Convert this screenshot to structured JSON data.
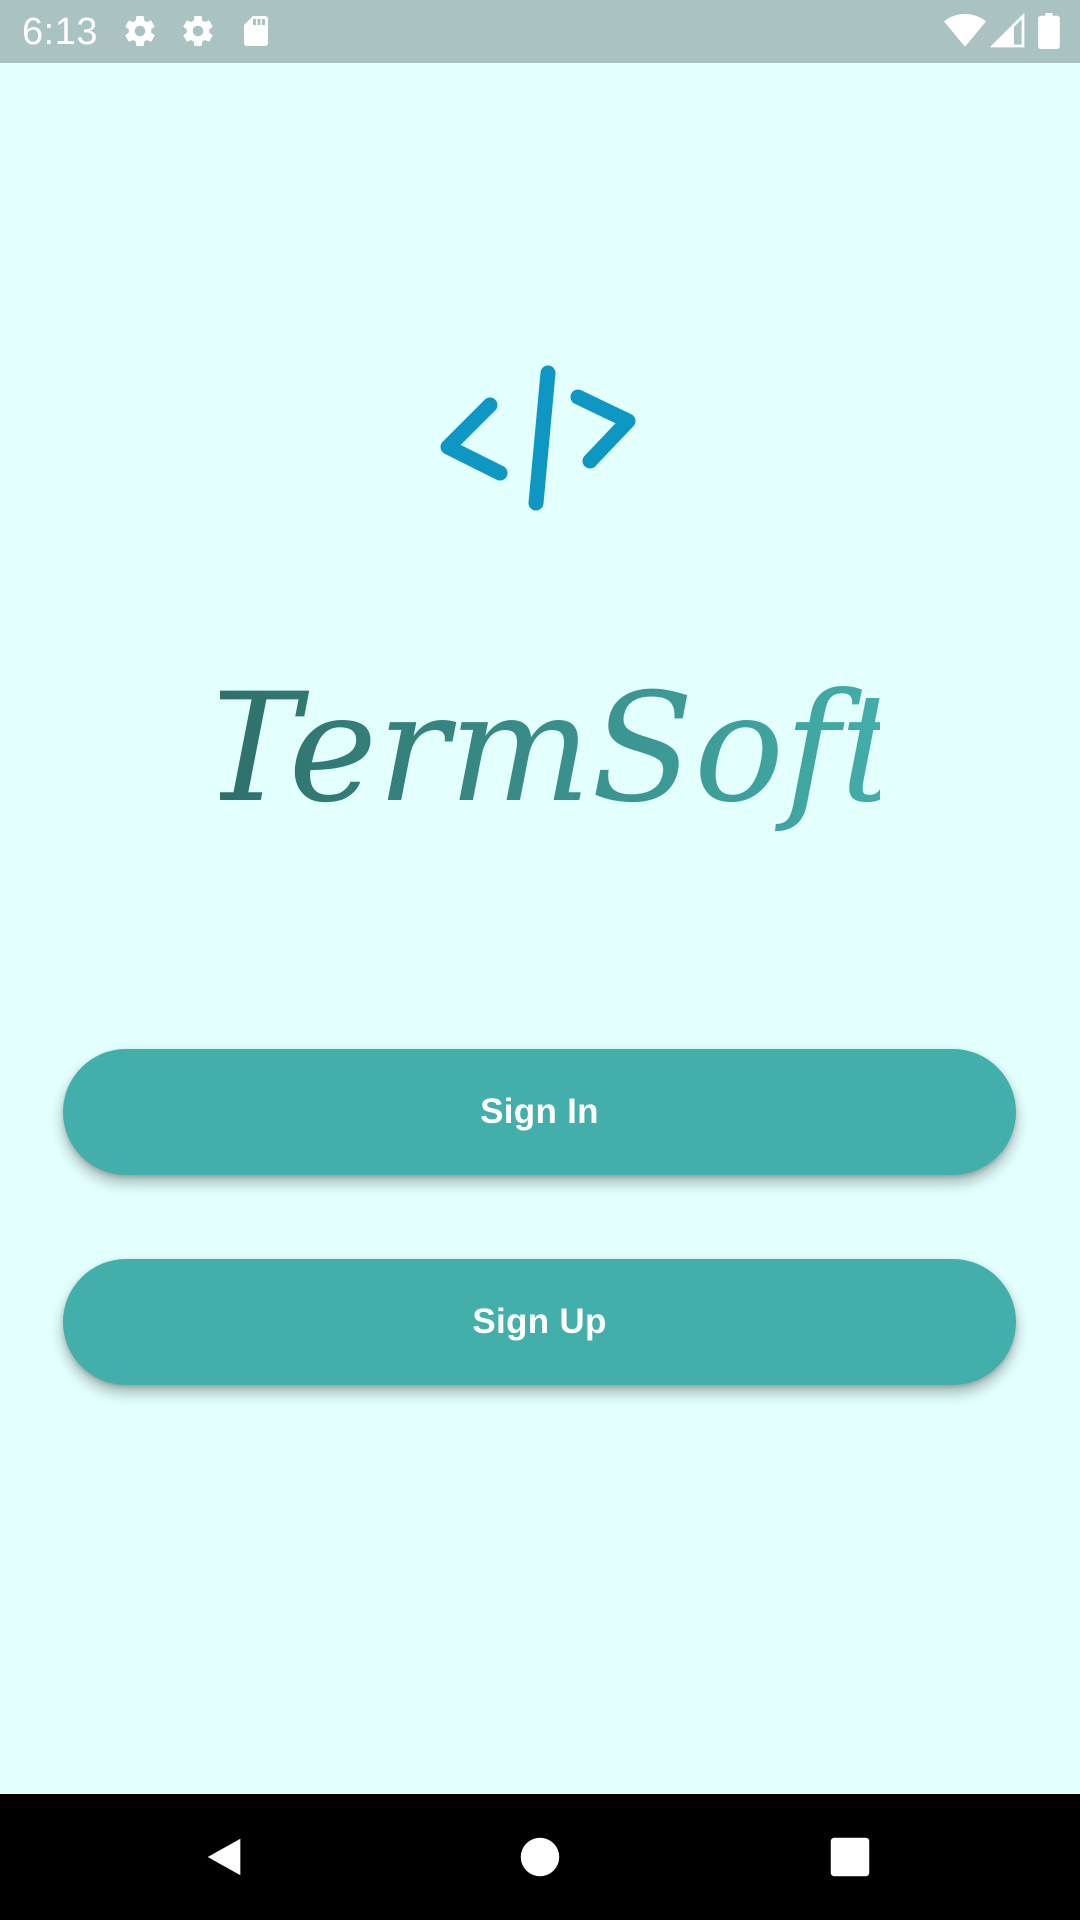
{
  "status_bar": {
    "time": "6:13",
    "left_icons": [
      "gear-icon",
      "gear-icon",
      "sd-card-icon"
    ],
    "right_icons": [
      "wifi-icon",
      "cell-signal-icon",
      "battery-icon"
    ]
  },
  "logo": {
    "mark": "</>",
    "wordmark": "TermSoft",
    "mark_color": "#0e97c2",
    "wordmark_color_start": "#2f6e69",
    "wordmark_color_end": "#43afab"
  },
  "actions": {
    "sign_in_label": "Sign In",
    "sign_up_label": "Sign Up",
    "button_color": "#43afab"
  },
  "nav_bar": {
    "back": "back-icon",
    "home": "home-icon",
    "recents": "recents-icon"
  }
}
